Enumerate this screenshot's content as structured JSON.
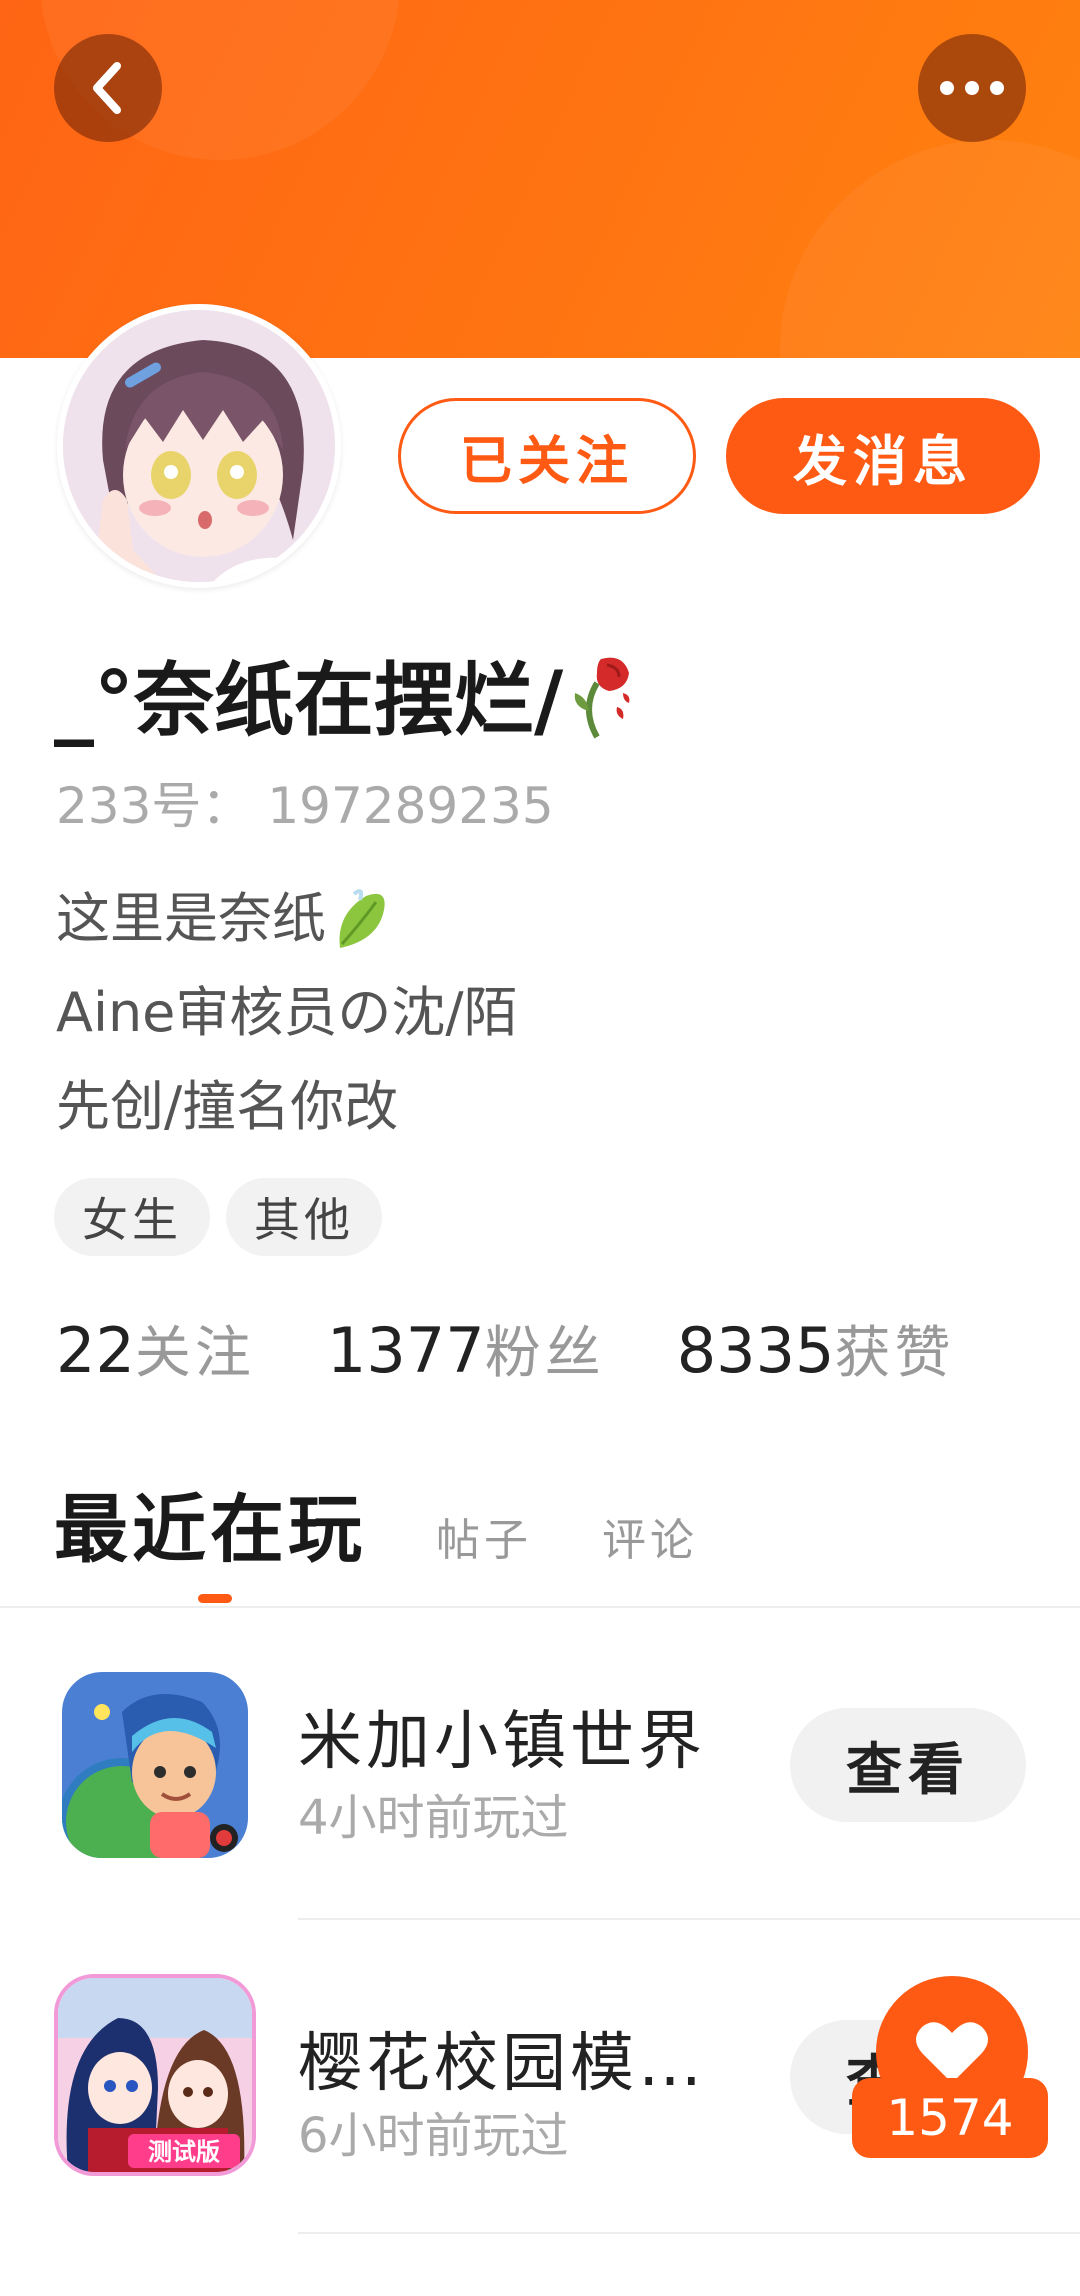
{
  "header": {
    "back_icon": "chevron-left-icon",
    "more_icon": "more-dots-icon",
    "accent_color": "#ff5a14"
  },
  "profile": {
    "followed_label": "已关注",
    "message_label": "发消息",
    "nickname": "_°奈纸在摆烂/",
    "nickname_emoji": "wilted-rose-icon",
    "uid": "233号：  197289235",
    "bio": [
      "这里是奈纸",
      "Aine审核员の沈/陌",
      "先创/撞名你改"
    ],
    "bio_emoji": "leaf-icon",
    "tags": [
      "女生",
      "其他"
    ],
    "stats": [
      {
        "num": "22",
        "label": "关注"
      },
      {
        "num": "1377",
        "label": "粉丝"
      },
      {
        "num": "8335",
        "label": "获赞"
      }
    ]
  },
  "tabs": {
    "active": "最近在玩",
    "items": [
      "帖子",
      "评论"
    ]
  },
  "games": [
    {
      "name": "米加小镇世界",
      "time": "4小时前玩过",
      "button": "查看"
    },
    {
      "name": "樱花校园模…",
      "time": "6小时前玩过",
      "button": "查看"
    }
  ],
  "like": {
    "count": "1574"
  }
}
